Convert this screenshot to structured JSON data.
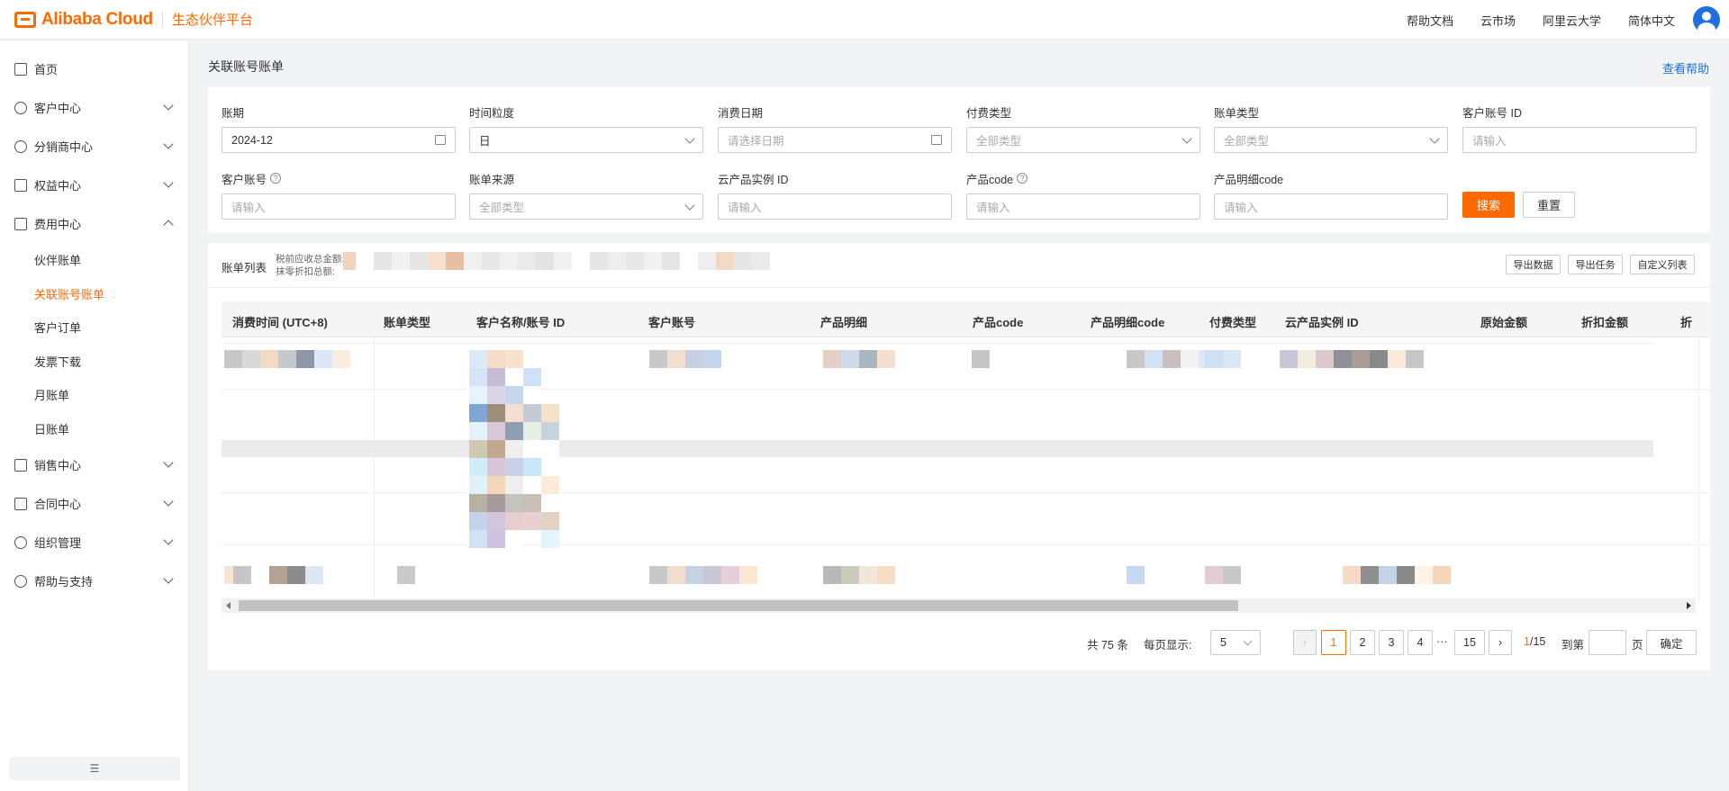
{
  "brand": {
    "name": "Alibaba Cloud",
    "sub": "生态伙伴平台",
    "color": "#ff6a00"
  },
  "top_links": [
    "帮助文档",
    "云市场",
    "阿里云大学",
    "简体中文"
  ],
  "sidebar": {
    "items": [
      {
        "label": "首页",
        "icon": "home-icon"
      },
      {
        "label": "客户中心",
        "icon": "user-icon"
      },
      {
        "label": "分销商中心",
        "icon": "group-icon"
      },
      {
        "label": "权益中心",
        "icon": "benefit-icon"
      },
      {
        "label": "费用中心",
        "icon": "billing-icon"
      },
      {
        "label": "销售中心",
        "icon": "bag-icon"
      },
      {
        "label": "合同中心",
        "icon": "contract-icon"
      },
      {
        "label": "组织管理",
        "icon": "org-icon"
      },
      {
        "label": "帮助与支持",
        "icon": "help-icon"
      }
    ],
    "sub_items": [
      "伙伴账单",
      "关联账号账单",
      "客户订单",
      "发票下载",
      "月账单",
      "日账单"
    ],
    "active": "关联账号账单"
  },
  "page": {
    "title": "关联账号账单",
    "help": "查看帮助"
  },
  "filters": {
    "period": {
      "label": "账期",
      "value": "2024-12"
    },
    "granularity": {
      "label": "时间粒度",
      "value": "日"
    },
    "consume_date": {
      "label": "消费日期",
      "placeholder": "请选择日期"
    },
    "pay_type": {
      "label": "付费类型",
      "placeholder": "全部类型"
    },
    "bill_type": {
      "label": "账单类型",
      "placeholder": "全部类型"
    },
    "customer_id": {
      "label": "客户账号 ID",
      "placeholder": "请输入"
    },
    "customer_account": {
      "label": "客户账号",
      "placeholder": "请输入"
    },
    "bill_source": {
      "label": "账单来源",
      "placeholder": "全部类型"
    },
    "instance_id": {
      "label": "云产品实例 ID",
      "placeholder": "请输入"
    },
    "product_code": {
      "label": "产品code",
      "placeholder": "请输入"
    },
    "product_detail_code": {
      "label": "产品明细code",
      "placeholder": "请输入"
    },
    "search": "搜索",
    "reset": "重置"
  },
  "list": {
    "title": "账单列表",
    "sub1": "税前应收总金额:",
    "sub2": "抹零折扣总额:",
    "buttons": [
      "导出数据",
      "导出任务",
      "自定义列表"
    ],
    "columns": [
      "消费时间 (UTC+8)",
      "账单类型",
      "客户名称/账号 ID",
      "客户账号",
      "产品明细",
      "产品code",
      "产品明细code",
      "付费类型",
      "云产品实例 ID",
      "原始金额",
      "折扣金额",
      "折"
    ]
  },
  "pagination": {
    "total": "共 75 条",
    "per_page_label": "每页显示:",
    "per_page": "5",
    "pages": [
      "1",
      "2",
      "3",
      "4",
      "15"
    ],
    "ellipsis": "···",
    "current": "1",
    "total_pages": "/15",
    "goto": "到第",
    "page_unit": "页",
    "confirm": "确定"
  }
}
